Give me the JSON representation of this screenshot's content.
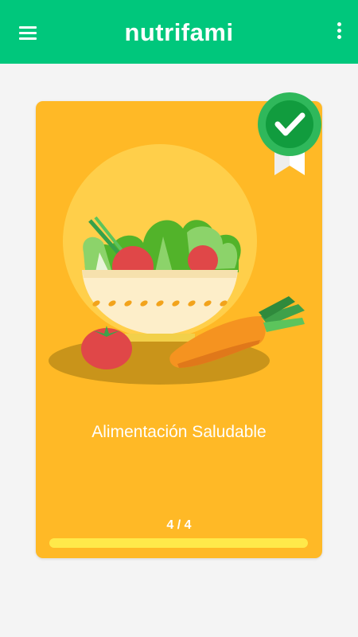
{
  "header": {
    "logo_text": "nutrifami",
    "menu_icon": "menu-icon",
    "more_icon": "more-vert-icon",
    "background_color": "#00c77c"
  },
  "module_card": {
    "title": "Alimentación Saludable",
    "progress_text": "4 / 4",
    "progress_fraction": 1.0,
    "completed": true,
    "badge_icon": "check-badge-icon",
    "background_color": "#ffb926"
  }
}
